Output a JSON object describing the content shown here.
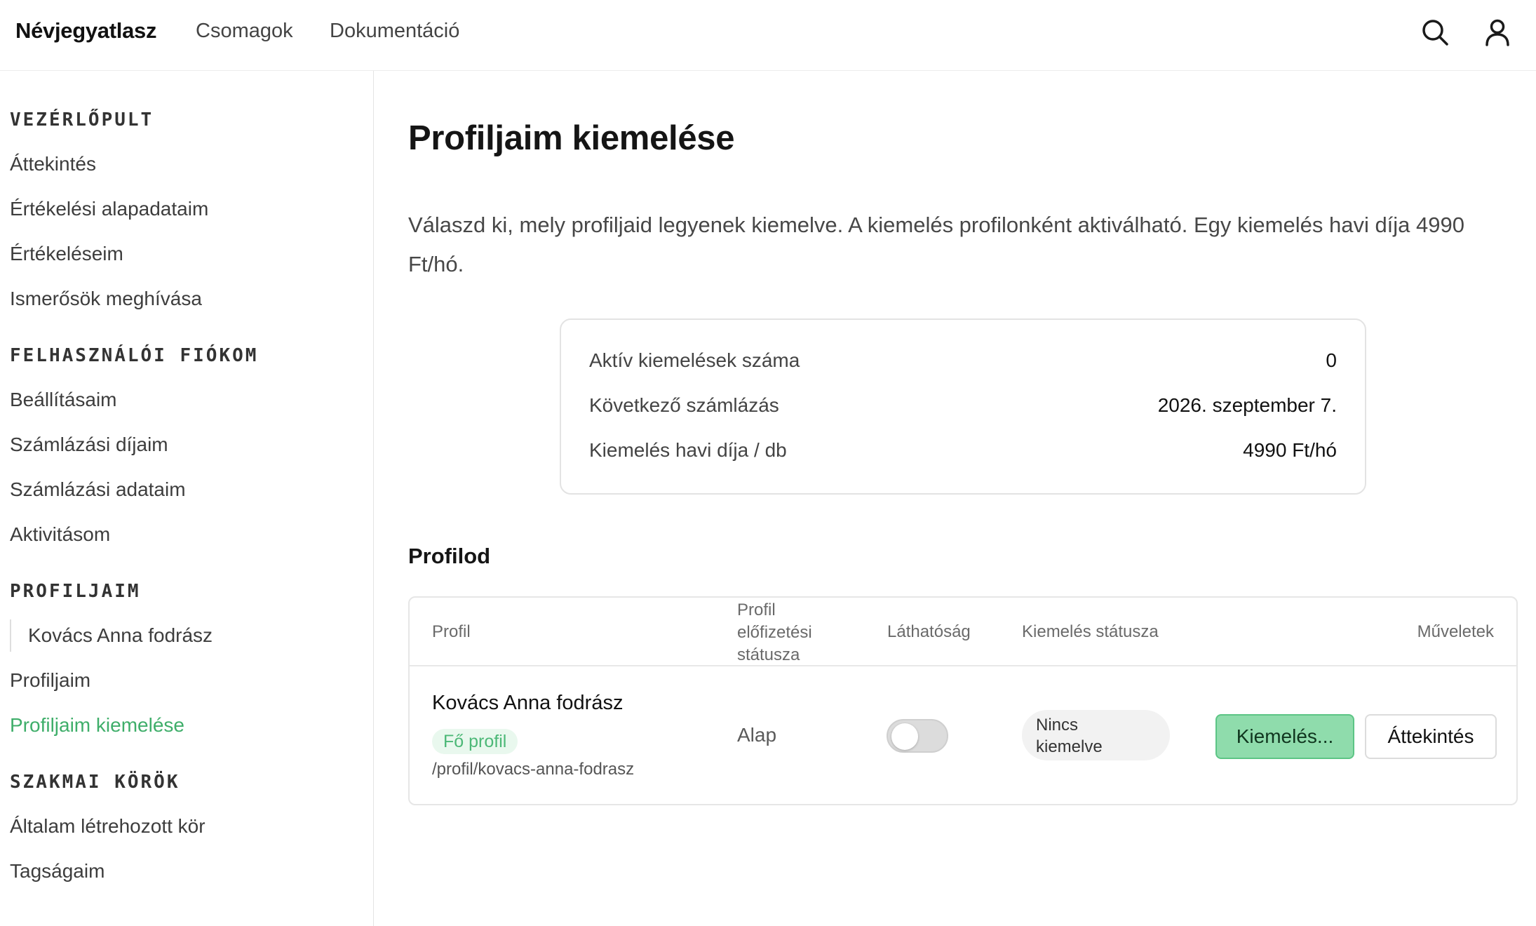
{
  "topbar": {
    "brand": "Névjegyatlasz",
    "nav": [
      "Csomagok",
      "Dokumentáció"
    ],
    "icons": [
      "search-icon",
      "user-icon"
    ]
  },
  "sidebar": {
    "dashboard_heading": "VEZÉRLŐPULT",
    "dashboard_items": [
      "Áttekintés",
      "Értékelési alapadataim",
      "Értékeléseim",
      "Ismerősök meghívása"
    ],
    "account_heading": "FELHASZNÁLÓI FIÓKOM",
    "account_items": [
      "Beállításaim",
      "Számlázási díjaim",
      "Számlázási adataim",
      "Aktivitásom"
    ],
    "profiles_heading": "PROFILJAIM",
    "profiles_sub_item": "Kovács Anna fodrász",
    "profiles_items": [
      "Profiljaim",
      "Profiljaim kiemelése"
    ],
    "circles_heading": "SZAKMAI KÖRÖK",
    "circles_items": [
      "Általam létrehozott kör",
      "Tagságaim"
    ],
    "active_color": "#3fae6a"
  },
  "main": {
    "title": "Profiljaim kiemelése",
    "intro": "Válaszd ki, mely profiljaid legyenek kiemelve. A kiemelés profilonként aktiválható. Egy kiemelés havi díja 4990 Ft/hó.",
    "summary": {
      "rows": [
        {
          "label": "Aktív kiemelések száma",
          "value": "0"
        },
        {
          "label": "Következő számlázás",
          "value": "2026. szeptember 7."
        },
        {
          "label": "Kiemelés havi díja / db",
          "value": "4990 Ft/hó"
        }
      ]
    },
    "section_title": "Profilod",
    "table": {
      "headers": {
        "profile": "Profil",
        "subscription_line1": "Profil",
        "subscription_line2": "előfizetési",
        "subscription_line3": "státusza",
        "visibility": "Láthatóság",
        "feature_status": "Kiemelés státusza",
        "actions": "Műveletek"
      },
      "row": {
        "name": "Kovács Anna fodrász",
        "badge": "Fő profil",
        "slug": "/profil/kovacs-anna-fodrasz",
        "plan": "Alap",
        "visible": false,
        "status_line1": "Nincs",
        "status_line2": "kiemelve",
        "feature_button": "Kiemelés...",
        "overview_button": "Áttekintés"
      }
    },
    "accent_color": "#8fdcac"
  }
}
